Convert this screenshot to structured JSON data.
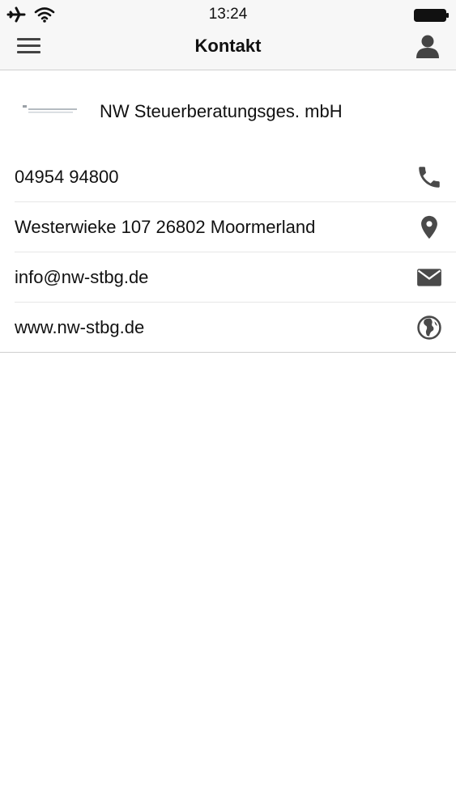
{
  "status_bar": {
    "time": "13:24",
    "icons": [
      "airplane-icon",
      "wifi-icon",
      "battery-icon"
    ]
  },
  "nav": {
    "title": "Kontakt",
    "left_icon": "menu-icon",
    "right_icon": "profile-icon"
  },
  "company": {
    "name": "NW Steuerberatungsges. mbH",
    "logo_icon": "company-logo"
  },
  "contacts": [
    {
      "text": "04954 94800",
      "icon": "phone-icon"
    },
    {
      "text": "Westerwieke 107 26802 Moormerland",
      "icon": "location-pin-icon"
    },
    {
      "text": "info@nw-stbg.de",
      "icon": "mail-icon"
    },
    {
      "text": "www.nw-stbg.de",
      "icon": "globe-icon"
    }
  ],
  "colors": {
    "bar_background": "#f7f7f7",
    "icon_gray": "#4a4a4a",
    "divider": "#e6e6e6",
    "text": "#111111"
  }
}
